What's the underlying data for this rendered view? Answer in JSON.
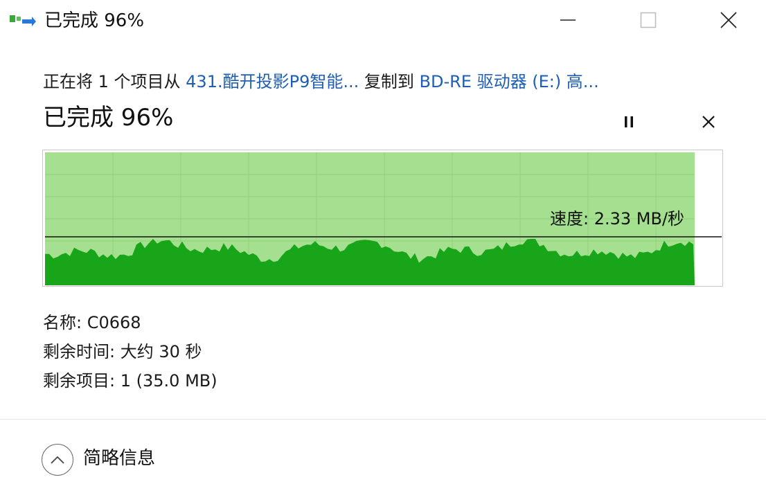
{
  "window": {
    "title": "已完成 96%",
    "controls": {
      "minimize": "minimize-icon",
      "maximize": "maximize-icon",
      "close": "close-icon"
    }
  },
  "copy_description": {
    "prefix": "正在将 1 个项目从 ",
    "source": "431.酷开投影P9智能...",
    "middle": " 复制到 ",
    "destination": "BD-RE 驱动器 (E:) 高..."
  },
  "progress": {
    "title": "已完成 96%",
    "percent": 96,
    "pause_icon": "pause-icon",
    "cancel_icon": "cancel-icon"
  },
  "speed_graph": {
    "speed_label": "速度: 2.33 MB/秒",
    "fill_color": "#a4e08f",
    "wave_color": "#19a519",
    "line_color": "#111111"
  },
  "details": {
    "name": {
      "label": "名称:",
      "value": "C0668"
    },
    "time_remaining": {
      "label": "剩余时间:",
      "value": "大约 30 秒"
    },
    "items_remaining": {
      "label": "剩余项目:",
      "value": "1 (35.0 MB)"
    }
  },
  "footer": {
    "toggle_label": "简略信息",
    "toggle_icon": "chevron-up-icon"
  }
}
